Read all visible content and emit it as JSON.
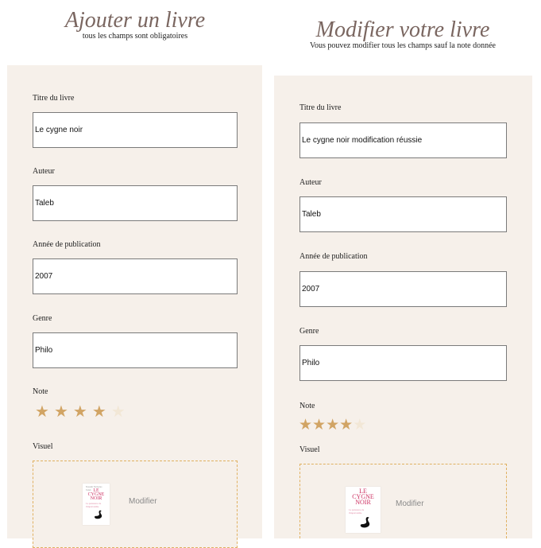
{
  "left": {
    "title": "Ajouter un livre",
    "subtitle": "tous les champs sont obligatoires",
    "fields": {
      "title_label": "Titre du livre",
      "title_value": "Le cygne noir",
      "author_label": "Auteur",
      "author_value": "Taleb",
      "year_label": "Année de publication",
      "year_value": "2007",
      "genre_label": "Genre",
      "genre_value": "Philo",
      "rating_label": "Note",
      "rating_value": 4,
      "rating_max": 5,
      "visual_label": "Visuel",
      "visual_action": "Modifier"
    },
    "cover": {
      "author": "Nassim Nicholas Taleb",
      "title_line1": "LE",
      "title_line2": "CYGNE",
      "title_line3": "NOIR",
      "subtitle": "La puissance de l'imprévisible"
    }
  },
  "right": {
    "title": "Modifier votre livre",
    "subtitle": "Vous pouvez modifier tous les champs sauf la note donnée",
    "fields": {
      "title_label": "Titre du livre",
      "title_value": "Le cygne noir modification réussie",
      "author_label": "Auteur",
      "author_value": "Taleb",
      "year_label": "Année de publication",
      "year_value": "2007",
      "genre_label": "Genre",
      "genre_value": "Philo",
      "rating_label": "Note",
      "rating_value": 4,
      "rating_max": 5,
      "visual_label": "Visuel",
      "visual_action": "Modifier"
    },
    "cover": {
      "title_line1": "LE",
      "title_line2": "CYGNE",
      "title_line3": "NOIR",
      "subtitle": "La puissance de l'imprévisible"
    }
  },
  "colors": {
    "panel_bg": "#f6f0ea",
    "title": "#7a6660",
    "star_on": "#d1a464",
    "star_off": "#f2e7d6",
    "dashed_border": "#e0b060",
    "cover_title": "#cc2f61"
  }
}
